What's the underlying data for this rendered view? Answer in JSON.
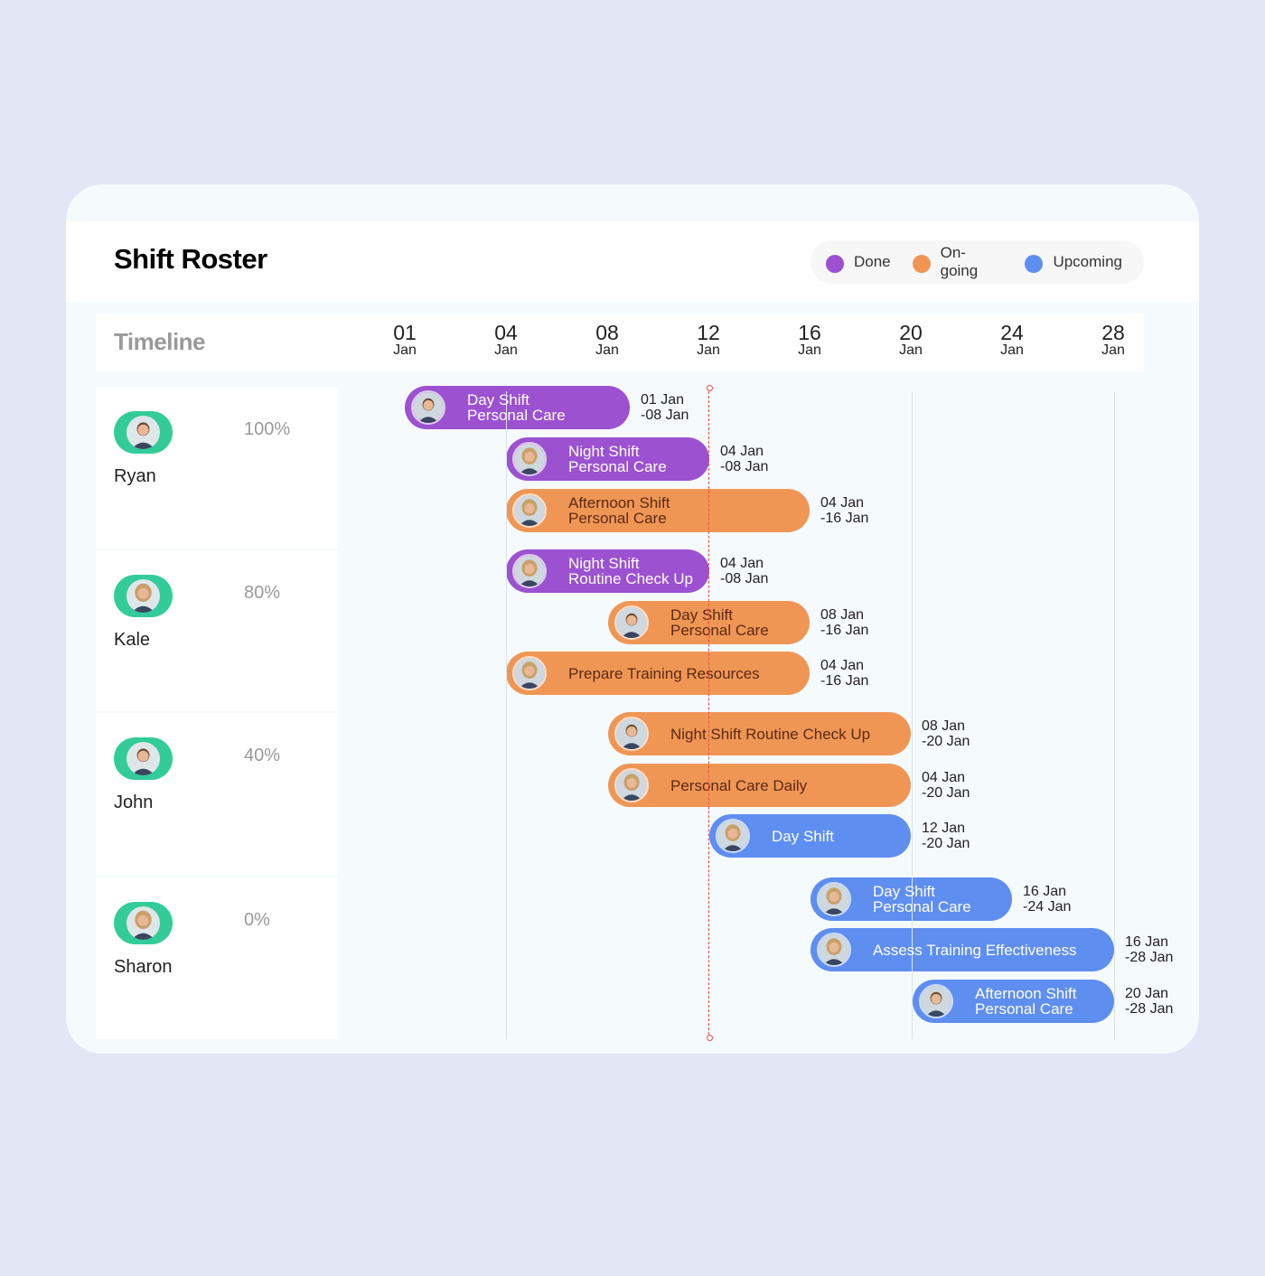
{
  "title": "Shift Roster",
  "legend": [
    {
      "label": "Done",
      "color": "#9b51d0"
    },
    {
      "label": "On-going",
      "color": "#f09655"
    },
    {
      "label": "Upcoming",
      "color": "#5e8ef0"
    }
  ],
  "timeline_label": "Timeline",
  "ticks": [
    {
      "d": "01",
      "m": "Jan"
    },
    {
      "d": "04",
      "m": "Jan"
    },
    {
      "d": "08",
      "m": "Jan"
    },
    {
      "d": "12",
      "m": "Jan"
    },
    {
      "d": "16",
      "m": "Jan"
    },
    {
      "d": "20",
      "m": "Jan"
    },
    {
      "d": "24",
      "m": "Jan"
    },
    {
      "d": "28",
      "m": "Jan"
    }
  ],
  "current_date_marker": "12 Jan",
  "people": [
    {
      "name": "Ryan",
      "percent": "100%",
      "avatar": "male-avatar"
    },
    {
      "name": "Kale",
      "percent": "80%",
      "avatar": "female-avatar"
    },
    {
      "name": "John",
      "percent": "40%",
      "avatar": "male-avatar"
    },
    {
      "name": "Sharon",
      "percent": "0%",
      "avatar": "female-avatar"
    }
  ],
  "shifts": [
    {
      "line1": "Day Shift",
      "line2": "Personal Care",
      "start": "01 Jan",
      "end": "-08 Jan",
      "status": "Done"
    },
    {
      "line1": "Night Shift",
      "line2": "Personal Care",
      "start": "04 Jan",
      "end": "-08 Jan",
      "status": "Done"
    },
    {
      "line1": "Afternoon Shift",
      "line2": "Personal Care",
      "start": "04 Jan",
      "end": "-16 Jan",
      "status": "On-going"
    },
    {
      "line1": "Night Shift",
      "line2": "Routine Check Up",
      "start": "04 Jan",
      "end": "-08 Jan",
      "status": "Done"
    },
    {
      "line1": "Day Shift",
      "line2": "Personal Care",
      "start": "08 Jan",
      "end": "-16 Jan",
      "status": "On-going"
    },
    {
      "line1": "Prepare Training Resources",
      "line2": "",
      "start": "04 Jan",
      "end": "-16 Jan",
      "status": "On-going"
    },
    {
      "line1": "Night Shift Routine Check Up",
      "line2": "",
      "start": "08 Jan",
      "end": "-20 Jan",
      "status": "On-going"
    },
    {
      "line1": "Personal Care Daily",
      "line2": "",
      "start": "04 Jan",
      "end": "-20 Jan",
      "status": "On-going"
    },
    {
      "line1": "Day Shift",
      "line2": "",
      "start": "12 Jan",
      "end": "-20 Jan",
      "status": "Upcoming"
    },
    {
      "line1": "Day Shift",
      "line2": "Personal Care",
      "start": "16 Jan",
      "end": "-24 Jan",
      "status": "Upcoming"
    },
    {
      "line1": "Assess Training Effectiveness",
      "line2": "",
      "start": "16 Jan",
      "end": "-28 Jan",
      "status": "Upcoming"
    },
    {
      "line1": "Afternoon Shift",
      "line2": "Personal Care",
      "start": "20 Jan",
      "end": "-28 Jan",
      "status": "Upcoming"
    }
  ],
  "colors": {
    "Done": "#9b51d0",
    "On-going": "#f09655",
    "Upcoming": "#5e8ef0",
    "pill": "#33cc99",
    "now_line": "#f04848"
  }
}
